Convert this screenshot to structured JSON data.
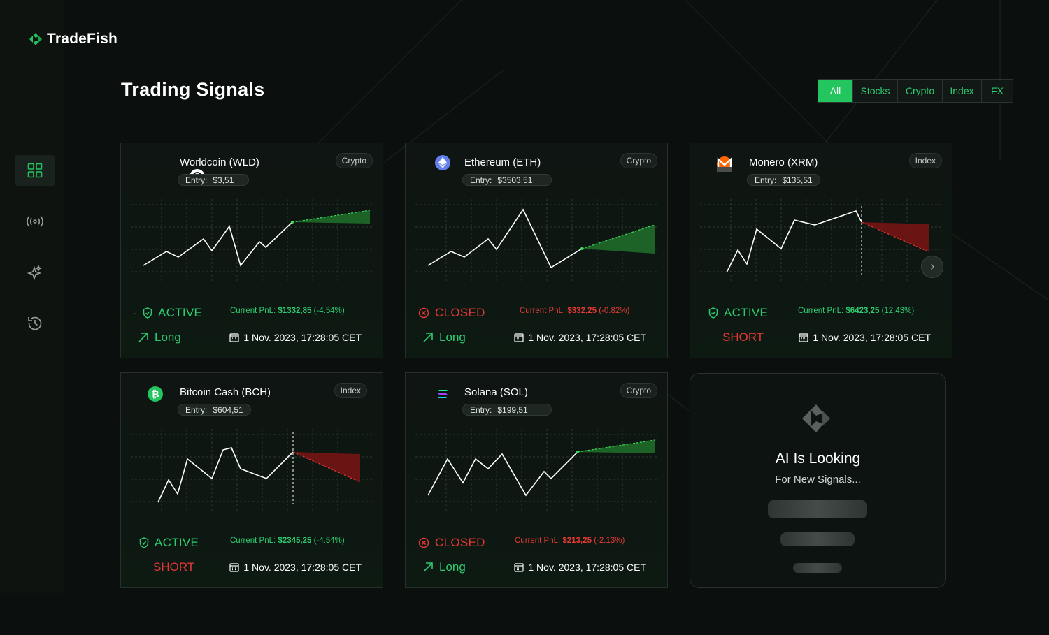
{
  "app": {
    "name": "TradeFish"
  },
  "page": {
    "title": "Trading Signals"
  },
  "filters": [
    "All",
    "Stocks",
    "Crypto",
    "Index",
    "FX"
  ],
  "active_filter": "All",
  "nav": [
    {
      "id": "dashboard",
      "icon": "grid-icon",
      "active": true
    },
    {
      "id": "signals",
      "icon": "broadcast-icon",
      "active": false
    },
    {
      "id": "ai",
      "icon": "sparkle-icon",
      "active": false
    },
    {
      "id": "history",
      "icon": "history-icon",
      "active": false
    }
  ],
  "signals": [
    {
      "name": "Worldcoin (WLD)",
      "entry_label": "Entry:",
      "entry": "$3,51",
      "category": "Crypto",
      "status": "ACTIVE",
      "pnl_label": "Current PnL:",
      "pnl_value": "$1332,85",
      "pnl_pct": "(-4.54%)",
      "direction": "Long",
      "date": "1 Nov. 2023, 17:28:05 CET",
      "icon": "worldcoin-icon"
    },
    {
      "name": "Ethereum (ETH)",
      "entry_label": "Entry:",
      "entry": "$3503,51",
      "category": "Crypto",
      "status": "CLOSED",
      "pnl_label": "Current PnL:",
      "pnl_value": "$332,25",
      "pnl_pct": "(-0.82%)",
      "direction": "Long",
      "date": "1 Nov. 2023, 17:28:05 CET",
      "icon": "ethereum-icon"
    },
    {
      "name": "Monero (XRM)",
      "entry_label": "Entry:",
      "entry": "$135,51",
      "category": "Index",
      "status": "ACTIVE",
      "pnl_label": "Current PnL:",
      "pnl_value": "$6423,25",
      "pnl_pct": "(12.43%)",
      "direction": "SHORT",
      "date": "1 Nov. 2023, 17:28:05 CET",
      "icon": "monero-icon"
    },
    {
      "name": "Bitcoin Cash (BCH)",
      "entry_label": "Entry:",
      "entry": "$604,51",
      "category": "Index",
      "status": "ACTIVE",
      "pnl_label": "Current PnL:",
      "pnl_value": "$2345,25",
      "pnl_pct": "(-4.54%)",
      "direction": "SHORT",
      "date": "1 Nov. 2023, 17:28:05 CET",
      "icon": "bitcoin-cash-icon"
    },
    {
      "name": "Solana (SOL)",
      "entry_label": "Entry:",
      "entry": "$199,51",
      "category": "Crypto",
      "status": "CLOSED",
      "pnl_label": "Current PnL:",
      "pnl_value": "$213,25",
      "pnl_pct": "(-2.13%)",
      "direction": "Long",
      "date": "1 Nov. 2023, 17:28:05 CET",
      "icon": "solana-icon"
    }
  ],
  "ai_card": {
    "title": "AI Is Looking",
    "subtitle": "For New Signals..."
  },
  "colors": {
    "accent": "#22c55e",
    "green_text": "#2ecc71",
    "red": "#e53935",
    "background": "#0b0f0d"
  }
}
